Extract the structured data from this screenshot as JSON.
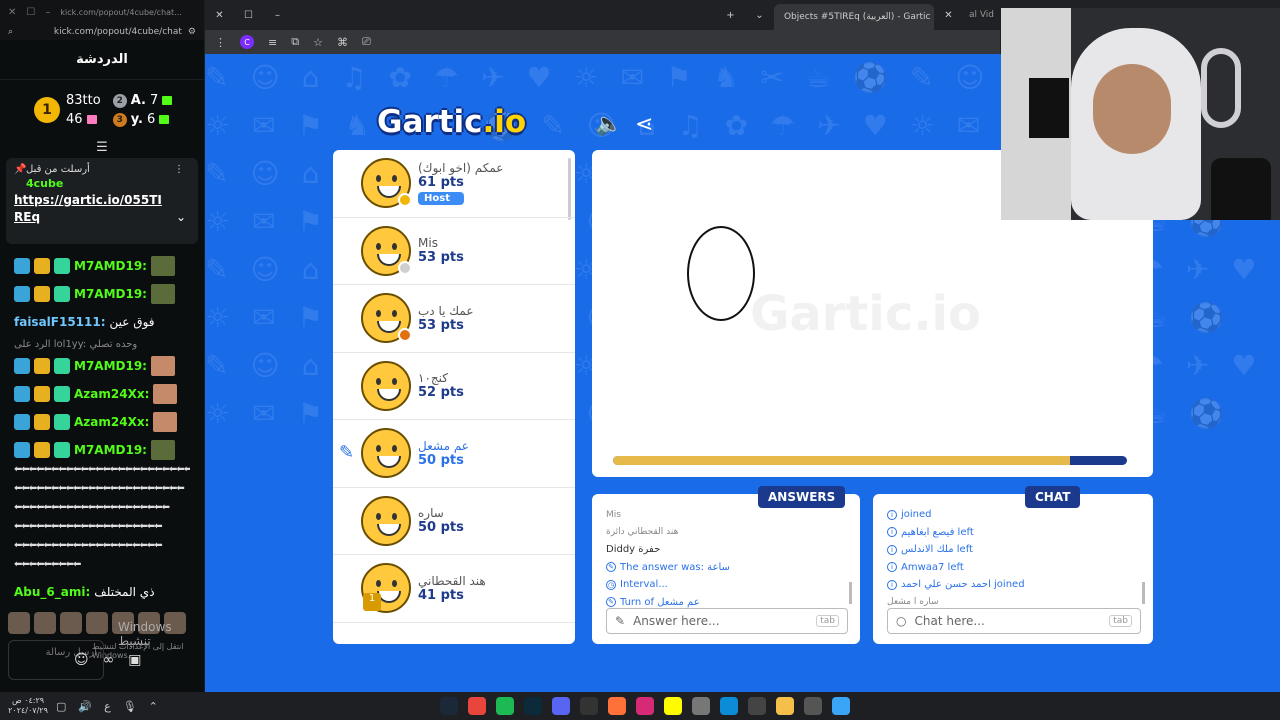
{
  "kick": {
    "window_url": "kick.com/popout/4cube/chat...",
    "address": "kick.com/popout/4cube/chat",
    "title": "الدردشة",
    "leaderboard": {
      "first_rank": "1",
      "first_name": "83tto",
      "first_amount": "46",
      "second_rank": "2",
      "second_name": "A.",
      "second_amount": "7",
      "third_rank": "3",
      "third_name": "y.",
      "third_amount": "6"
    },
    "pinned": {
      "header": "أرسلت من قبل",
      "user": "4cube",
      "link": "https://gartic.io/055TIREq"
    },
    "messages": [
      {
        "user": "M7AMD19:",
        "text": ""
      },
      {
        "user": "M7AMD19:",
        "text": ""
      },
      {
        "user": "faisalF15111:",
        "text": "فوق عين"
      },
      {
        "user": "M7AMD19:",
        "text": "",
        "reply": "الرد على lol1yy: وحده تصلي"
      },
      {
        "user": "Azam24Xx:",
        "text": ""
      },
      {
        "user": "Azam24Xx:",
        "text": ""
      },
      {
        "user": "M7AMD19:",
        "text": ""
      }
    ],
    "spam_lines": [
      "⬅⬅⬅⬅⬅⬅⬅⬅⬅⬅⬅⬅⬅⬅⬅⬅⬅⬅⬅⬅⬅⬅⬅⬅",
      "⬅⬅⬅⬅⬅⬅⬅⬅⬅⬅⬅⬅⬅⬅⬅⬅⬅⬅⬅⬅⬅⬅⬅",
      "⬅⬅⬅⬅⬅⬅⬅⬅⬅⬅⬅⬅⬅⬅⬅⬅⬅⬅⬅⬅⬅",
      "⬅⬅⬅⬅⬅⬅⬅⬅⬅⬅⬅⬅⬅⬅⬅⬅⬅⬅⬅⬅",
      "⬅⬅⬅⬅⬅⬅⬅⬅⬅⬅⬅⬅⬅⬅⬅⬅⬅⬅⬅⬅",
      "⬅⬅⬅⬅⬅⬅⬅⬅⬅"
    ],
    "last_message": {
      "user": "Abu_6_ami:",
      "text": "ذي المختلف"
    },
    "input_placeholder": "ارسل رسالة",
    "windows_notice": "Windows تنشيط",
    "windows_notice2": "انتقل إلى الإعدادات لتنشيط Windows."
  },
  "browser": {
    "tab_title": "Objects #5TIREq (العربية) - Gartic",
    "tab2_title": "al Vid"
  },
  "gartic": {
    "logo_main": "Gartic",
    "logo_io": ".io",
    "watermark": "Gartic.io",
    "timer_progress": 0.89,
    "players": [
      {
        "name": "عمكم (اخو ابوك)",
        "points": "61 pts",
        "status": "#f2b705",
        "host": "Host",
        "drawing": false
      },
      {
        "name": "Mis",
        "points": "53 pts",
        "status": "#cfcfcf",
        "drawing": false
      },
      {
        "name": "عمك يا دب",
        "points": "53 pts",
        "status": "#e07010",
        "drawing": false
      },
      {
        "name": "كنج١٠",
        "points": "52 pts",
        "status": "",
        "drawing": false
      },
      {
        "name": "عم مشعل",
        "points": "50 pts",
        "status": "",
        "drawing": true
      },
      {
        "name": "ساره",
        "points": "50 pts",
        "status": "",
        "drawing": false
      },
      {
        "name": "هند القحطاني",
        "points": "41 pts",
        "status": "",
        "drawing": false,
        "trophy": "1"
      }
    ],
    "answers": {
      "label": "ANSWERS",
      "lines": [
        {
          "text": "Mis",
          "class": "gray",
          "icon": ""
        },
        {
          "text": "هند القحطاني دائرة",
          "class": "gray",
          "icon": ""
        },
        {
          "text": "Diddy حفرة",
          "class": "",
          "icon": ""
        },
        {
          "text": "The answer was: ساعة",
          "class": "blue",
          "icon": "✎"
        },
        {
          "text": "Interval...",
          "class": "blue",
          "icon": "◷"
        },
        {
          "text": "Turn of عم مشعل",
          "class": "blue",
          "icon": "✎"
        }
      ],
      "placeholder": "Answer here...",
      "tab": "tab"
    },
    "chat": {
      "label": "CHAT",
      "lines": [
        {
          "text": "joined",
          "class": "blue",
          "icon": "i"
        },
        {
          "text": "فيصع ابغاهيم left",
          "class": "blue",
          "icon": "i"
        },
        {
          "text": "ملك الاندلس left",
          "class": "blue",
          "icon": "i"
        },
        {
          "text": "Amwaa7 left",
          "class": "blue",
          "icon": "i"
        },
        {
          "text": "احمد حسن علي احمد joined",
          "class": "blue",
          "icon": "i"
        },
        {
          "text": "ساره ا مشعل",
          "class": "gray",
          "icon": ""
        }
      ],
      "placeholder": "Chat here...",
      "tab": "tab"
    }
  },
  "taskbar": {
    "time": "٠٤:٢٩ ص",
    "date": "٢٠٢٤/٠٧/٢٩",
    "lang": "ع"
  },
  "colors": {
    "page_blue": "#1a6be8",
    "kick_green": "#53fc18",
    "gartic_navy": "#1b3a8d"
  }
}
